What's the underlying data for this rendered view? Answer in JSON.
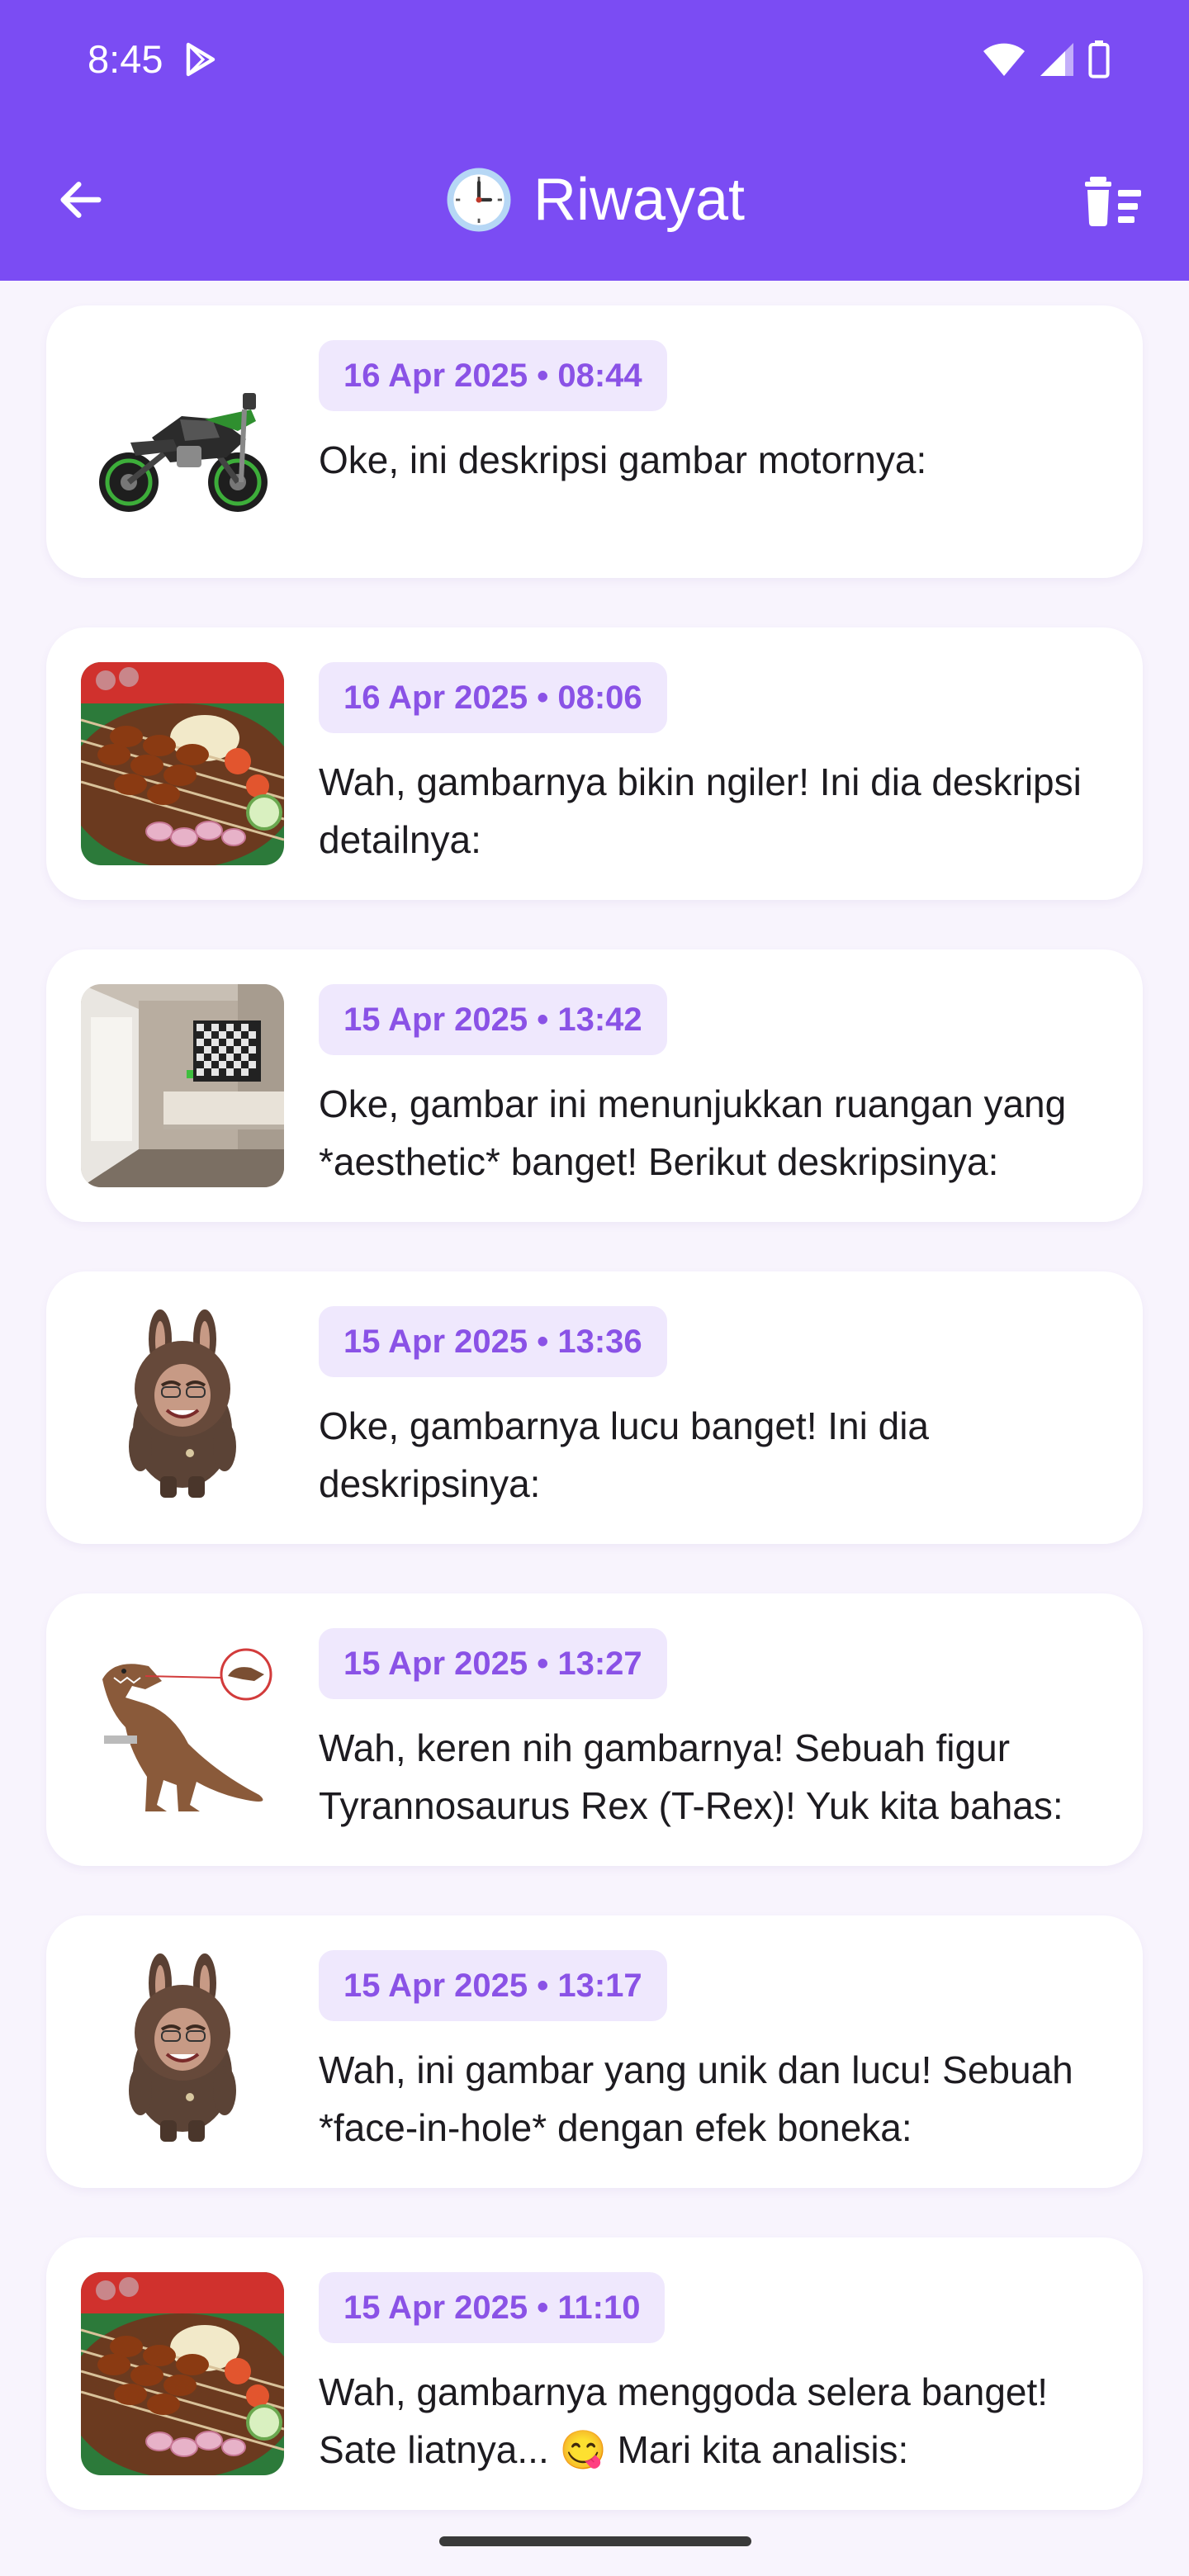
{
  "status_bar": {
    "time": "8:45"
  },
  "header": {
    "title": "Riwayat",
    "icons": {
      "back": "arrow-left-icon",
      "title": "clock-icon",
      "clear": "delete-sweep-icon"
    }
  },
  "history": [
    {
      "date": "16 Apr 2025 • 08:44",
      "text": "Oke, ini deskripsi gambar motornya:",
      "thumb": "motorcycle"
    },
    {
      "date": "16 Apr 2025 • 08:06",
      "text": "Wah, gambarnya bikin ngiler!  Ini dia deskripsi detailnya:",
      "thumb": "satay"
    },
    {
      "date": "15 Apr 2025 • 13:42",
      "text": "Oke, gambar ini menunjukkan ruangan yang *aesthetic* banget!  Berikut deskripsinya:",
      "thumb": "room"
    },
    {
      "date": "15 Apr 2025 • 13:36",
      "text": "Oke, gambarnya lucu banget!  Ini dia deskripsinya:",
      "thumb": "doll"
    },
    {
      "date": "15 Apr 2025 • 13:27",
      "text": "Wah, keren nih gambarnya! Sebuah figur Tyrannosaurus Rex (T-Rex)! Yuk kita bahas:",
      "thumb": "trex"
    },
    {
      "date": "15 Apr 2025 • 13:17",
      "text": "Wah, ini gambar yang unik dan lucu! Sebuah *face-in-hole* dengan efek boneka:",
      "thumb": "doll"
    },
    {
      "date": "15 Apr 2025 • 11:10",
      "text": "Wah, gambarnya menggoda selera banget!  Sate liatnya... 😋  Mari kita analisis:",
      "thumb": "satay"
    }
  ],
  "colors": {
    "primary": "#7b4cf3",
    "chip_bg": "#efe8fd",
    "chip_text": "#8a52e6",
    "background": "#f8f4fd"
  }
}
